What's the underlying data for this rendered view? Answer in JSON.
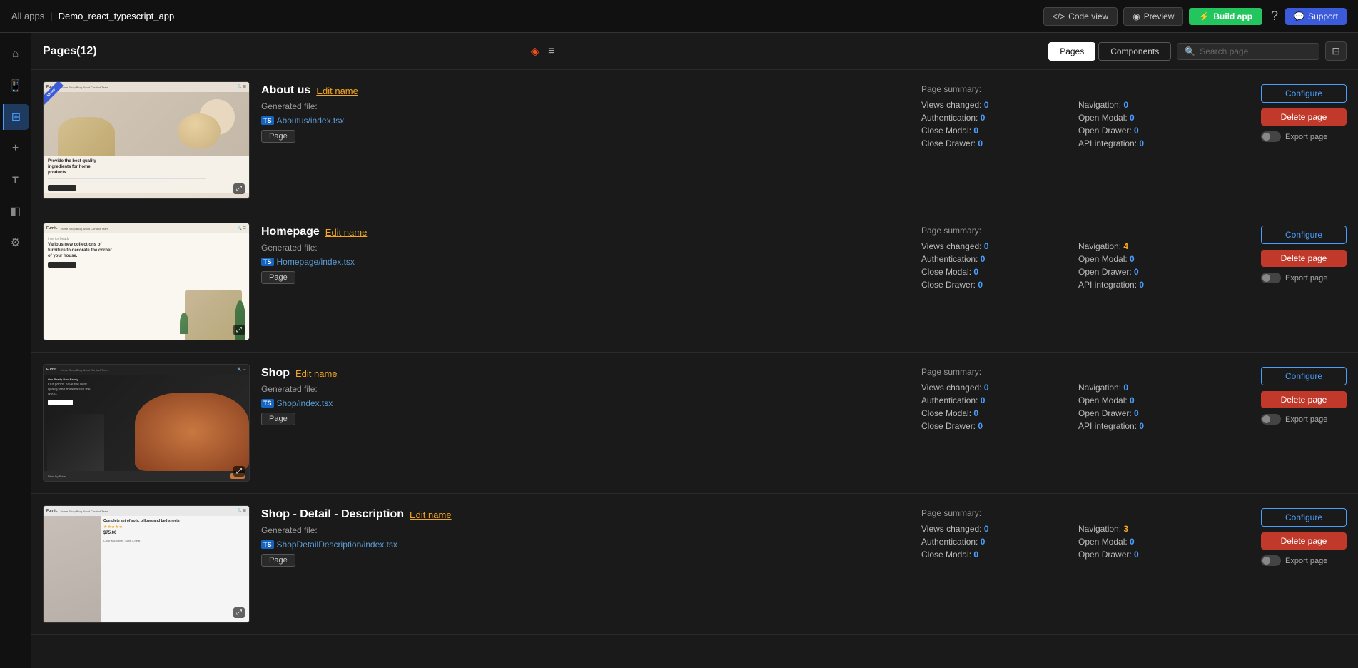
{
  "topbar": {
    "allapps_label": "All apps",
    "separator": "|",
    "app_name": "Demo_react_typescript_app",
    "code_view_label": "Code view",
    "preview_label": "Preview",
    "build_app_label": "Build app",
    "support_label": "Support"
  },
  "header": {
    "title": "Pages(12)",
    "tab_pages": "Pages",
    "tab_components": "Components",
    "search_placeholder": "Search page"
  },
  "pages": [
    {
      "id": "about-us",
      "name": "About us",
      "edit_label": "Edit name",
      "generated_label": "Generated file:",
      "file_path": "Aboutus/index.tsx",
      "tag": "Page",
      "summary_title": "Page summary:",
      "summary": [
        {
          "label": "Views changed:",
          "val": "0",
          "col": 1
        },
        {
          "label": "Navigation:",
          "val": "0",
          "col": 2
        },
        {
          "label": "Authentication:",
          "val": "0",
          "col": 1
        },
        {
          "label": "Open Modal:",
          "val": "0",
          "col": 2
        },
        {
          "label": "Close Modal:",
          "val": "0",
          "col": 1
        },
        {
          "label": "Open Drawer:",
          "val": "0",
          "col": 2
        },
        {
          "label": "Close Drawer:",
          "val": "0",
          "col": 1
        },
        {
          "label": "API integration:",
          "val": "0",
          "col": 2
        }
      ],
      "btn_configure": "Configure",
      "btn_delete": "Delete page",
      "export_label": "Export page",
      "thumb_type": "aboutus",
      "thumb_badge": "Home"
    },
    {
      "id": "homepage",
      "name": "Homepage",
      "edit_label": "Edit name",
      "generated_label": "Generated file:",
      "file_path": "Homepage/index.tsx",
      "tag": "Page",
      "summary_title": "Page summary:",
      "summary": [
        {
          "label": "Views changed:",
          "val": "0",
          "col": 1
        },
        {
          "label": "Navigation:",
          "val": "4",
          "col": 2,
          "highlight": true
        },
        {
          "label": "Authentication:",
          "val": "0",
          "col": 1
        },
        {
          "label": "Open Modal:",
          "val": "0",
          "col": 2
        },
        {
          "label": "Close Modal:",
          "val": "0",
          "col": 1
        },
        {
          "label": "Open Drawer:",
          "val": "0",
          "col": 2
        },
        {
          "label": "Close Drawer:",
          "val": "0",
          "col": 1
        },
        {
          "label": "API integration:",
          "val": "0",
          "col": 2
        }
      ],
      "btn_configure": "Configure",
      "btn_delete": "Delete page",
      "export_label": "Export page",
      "thumb_type": "homepage"
    },
    {
      "id": "shop",
      "name": "Shop",
      "edit_label": "Edit name",
      "generated_label": "Generated file:",
      "file_path": "Shop/index.tsx",
      "tag": "Page",
      "summary_title": "Page summary:",
      "summary": [
        {
          "label": "Views changed:",
          "val": "0",
          "col": 1
        },
        {
          "label": "Navigation:",
          "val": "0",
          "col": 2
        },
        {
          "label": "Authentication:",
          "val": "0",
          "col": 1
        },
        {
          "label": "Open Modal:",
          "val": "0",
          "col": 2
        },
        {
          "label": "Close Modal:",
          "val": "0",
          "col": 1
        },
        {
          "label": "Open Drawer:",
          "val": "0",
          "col": 2
        },
        {
          "label": "Close Drawer:",
          "val": "0",
          "col": 1
        },
        {
          "label": "API integration:",
          "val": "0",
          "col": 2
        }
      ],
      "btn_configure": "Configure",
      "btn_delete": "Delete page",
      "export_label": "Export page",
      "thumb_type": "shop"
    },
    {
      "id": "shop-detail",
      "name": "Shop - Detail - Description",
      "edit_label": "Edit name",
      "generated_label": "Generated file:",
      "file_path": "ShopDetailDescription/index.tsx",
      "tag": "Page",
      "summary_title": "Page summary:",
      "summary": [
        {
          "label": "Views changed:",
          "val": "0",
          "col": 1
        },
        {
          "label": "Navigation:",
          "val": "3",
          "col": 2,
          "highlight": true
        },
        {
          "label": "Authentication:",
          "val": "0",
          "col": 1
        },
        {
          "label": "Open Modal:",
          "val": "0",
          "col": 2
        },
        {
          "label": "Close Modal:",
          "val": "0",
          "col": 1
        },
        {
          "label": "Open Drawer:",
          "val": "0",
          "col": 2
        }
      ],
      "btn_configure": "Configure",
      "btn_delete": "Delete page",
      "export_label": "Export page",
      "thumb_type": "shopdetail"
    }
  ],
  "icons": {
    "code": "</>",
    "eye": "◉",
    "bolt": "⚡",
    "home": "⌂",
    "phone": "📱",
    "plus": "+",
    "text_t": "T",
    "group": "⊞",
    "gear": "⚙",
    "search": "🔍",
    "question": "?",
    "chat": "💬",
    "settings_panel": "⊟",
    "expand": "⤢",
    "figma": "◈",
    "list": "≡"
  }
}
